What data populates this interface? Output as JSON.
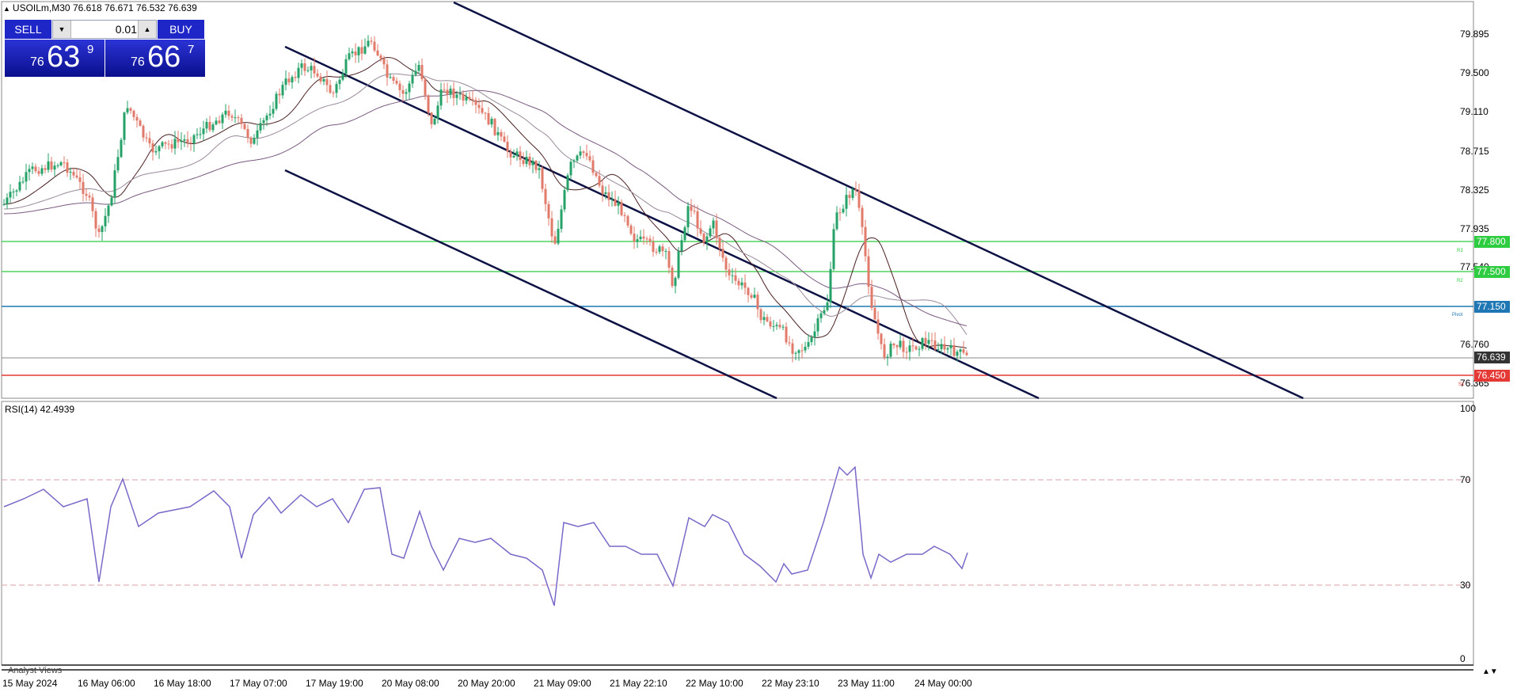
{
  "header": {
    "symbol_line": "USOILm,M30  76.618 76.671 76.532 76.639"
  },
  "trade_panel": {
    "sell_label": "SELL",
    "buy_label": "BUY",
    "lot_value": "0.01",
    "sell_price": {
      "prefix": "76",
      "big": "63",
      "sup": "9"
    },
    "buy_price": {
      "prefix": "76",
      "big": "66",
      "sup": "7"
    }
  },
  "price_axis": {
    "ticks": [
      "79.895",
      "79.500",
      "79.110",
      "78.715",
      "78.325",
      "77.935",
      "77.540",
      "76.760",
      "76.365"
    ]
  },
  "levels": {
    "r3": {
      "value": "77.800",
      "label": "R3",
      "color": "#2ecc40"
    },
    "r2": {
      "value": "77.500",
      "label": "R2",
      "color": "#2ecc40"
    },
    "pivot": {
      "value": "77.150",
      "label": "Pivot",
      "color": "#1f78b4"
    },
    "s1": {
      "value": "76.450",
      "label": "S1",
      "color": "#e53935"
    },
    "current": {
      "value": "76.639",
      "color": "#333333"
    }
  },
  "rsi": {
    "label": "RSI(14) 42.4939",
    "levels": [
      "100",
      "70",
      "30",
      "0"
    ],
    "line_color": "#7b68c8"
  },
  "time_axis": {
    "labels": [
      "15 May 2024",
      "16 May 06:00",
      "16 May 18:00",
      "17 May 07:00",
      "17 May 19:00",
      "20 May 08:00",
      "20 May 20:00",
      "21 May 09:00",
      "21 May 22:10",
      "22 May 10:00",
      "22 May 23:10",
      "23 May 11:00",
      "24 May 00:00"
    ]
  },
  "footer": {
    "analyst_label": "Analyst Views"
  },
  "colors": {
    "bull_candle": "#26a269",
    "bear_candle": "#e07a6a",
    "channel": "#0d1245",
    "ma_fast": "#4a2020",
    "ma_slow": "#7a5a80",
    "panel_blue": "#1e26c8"
  }
}
